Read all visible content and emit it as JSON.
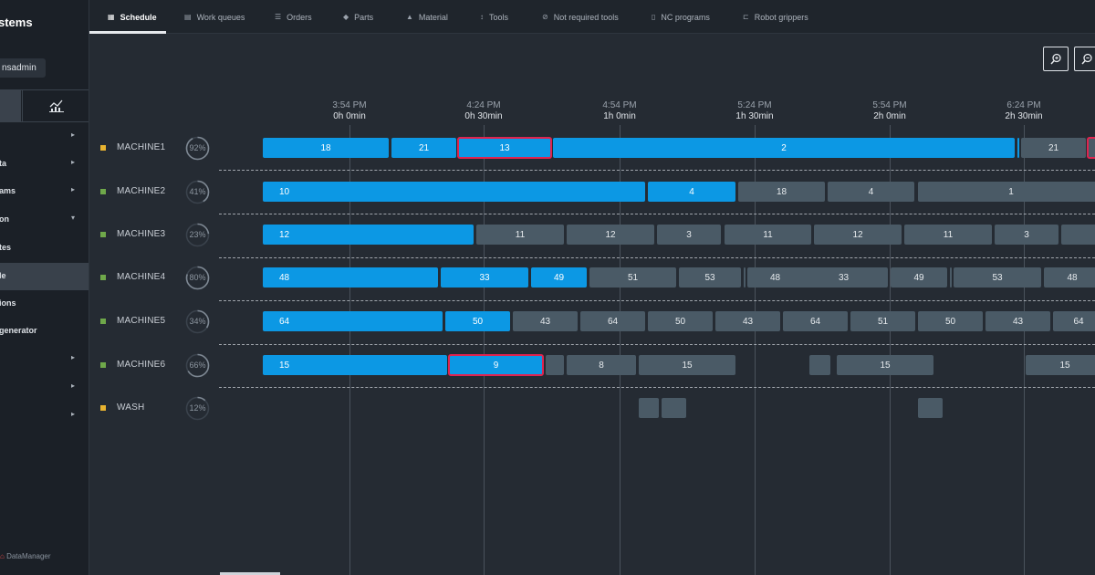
{
  "sidebar": {
    "brand": "stems",
    "user": "nsadmin",
    "items": [
      {
        "label": "",
        "chevron": "▸",
        "active": false
      },
      {
        "label": "ta",
        "chevron": "▸",
        "active": false
      },
      {
        "label": "ams",
        "chevron": "▸",
        "active": false
      },
      {
        "label": "on",
        "chevron": "▾",
        "active": false
      },
      {
        "label": "tes",
        "chevron": "",
        "active": false
      },
      {
        "label": "le",
        "chevron": "",
        "active": true
      },
      {
        "label": "ions",
        "chevron": "",
        "active": false
      },
      {
        "label": "generator",
        "chevron": "",
        "active": false
      },
      {
        "label": "",
        "chevron": "▸",
        "active": false
      },
      {
        "label": "",
        "chevron": "▸",
        "active": false
      },
      {
        "label": "",
        "chevron": "▸",
        "active": false
      }
    ],
    "footer": "DataManager"
  },
  "tabs": [
    {
      "label": "Schedule",
      "icon": "calendar-icon",
      "glyph": "▦",
      "active": true
    },
    {
      "label": "Work queues",
      "icon": "queue-icon",
      "glyph": "▤",
      "active": false
    },
    {
      "label": "Orders",
      "icon": "list-icon",
      "glyph": "☰",
      "active": false
    },
    {
      "label": "Parts",
      "icon": "part-icon",
      "glyph": "◆",
      "active": false
    },
    {
      "label": "Material",
      "icon": "material-icon",
      "glyph": "▲",
      "active": false
    },
    {
      "label": "Tools",
      "icon": "tool-icon",
      "glyph": "↕",
      "active": false
    },
    {
      "label": "Not required tools",
      "icon": "not-required-icon",
      "glyph": "⊘",
      "active": false
    },
    {
      "label": "NC programs",
      "icon": "nc-program-icon",
      "glyph": "▯",
      "active": false
    },
    {
      "label": "Robot grippers",
      "icon": "gripper-icon",
      "glyph": "⊏",
      "active": false
    }
  ],
  "timeline": [
    {
      "clock": "3:54 PM",
      "elapsed": "0h 0min"
    },
    {
      "clock": "4:24 PM",
      "elapsed": "0h 30min"
    },
    {
      "clock": "4:54 PM",
      "elapsed": "1h 0min"
    },
    {
      "clock": "5:24 PM",
      "elapsed": "1h 30min"
    },
    {
      "clock": "5:54 PM",
      "elapsed": "2h 0min"
    },
    {
      "clock": "6:24 PM",
      "elapsed": "2h 30min"
    }
  ],
  "colors": {
    "running": "#0c98e4",
    "queued": "#4a5a66",
    "selected_outline": "#e0234f",
    "status_warning": "#e8b330",
    "status_ok": "#6fa84a"
  },
  "machines": [
    {
      "name": "MACHINE1",
      "status": "warning",
      "utilization": 92,
      "utilization_label": "92%",
      "jobs": [
        {
          "label": "18",
          "kind": "running",
          "start": 288,
          "end": 426
        },
        {
          "label": "21",
          "kind": "running",
          "start": 429,
          "end": 500
        },
        {
          "label": "13",
          "kind": "running",
          "start": 502,
          "end": 604,
          "selected": true
        },
        {
          "label": "2",
          "kind": "running",
          "start": 606,
          "end": 1112
        },
        {
          "label": "",
          "kind": "running",
          "start": 1115,
          "end": 1117
        },
        {
          "label": "21",
          "kind": "queued",
          "start": 1119,
          "end": 1190
        },
        {
          "label": "",
          "kind": "queued",
          "start": 1192,
          "end": 1210,
          "selected": true
        }
      ]
    },
    {
      "name": "MACHINE2",
      "status": "ok",
      "utilization": 41,
      "utilization_label": "41%",
      "jobs": [
        {
          "label": "10",
          "kind": "running",
          "start": 288,
          "end": 707,
          "pad": true
        },
        {
          "label": "4",
          "kind": "running",
          "start": 710,
          "end": 806
        },
        {
          "label": "18",
          "kind": "queued",
          "start": 809,
          "end": 904
        },
        {
          "label": "4",
          "kind": "queued",
          "start": 907,
          "end": 1002
        },
        {
          "label": "1",
          "kind": "queued",
          "start": 1006,
          "end": 1396
        }
      ]
    },
    {
      "name": "MACHINE3",
      "status": "ok",
      "utilization": 23,
      "utilization_label": "23%",
      "jobs": [
        {
          "label": "12",
          "kind": "running",
          "start": 288,
          "end": 519,
          "pad": true
        },
        {
          "label": "11",
          "kind": "queued",
          "start": 522,
          "end": 618
        },
        {
          "label": "12",
          "kind": "queued",
          "start": 621,
          "end": 717
        },
        {
          "label": "3",
          "kind": "queued",
          "start": 720,
          "end": 790
        },
        {
          "label": "11",
          "kind": "queued",
          "start": 794,
          "end": 889
        },
        {
          "label": "12",
          "kind": "queued",
          "start": 892,
          "end": 988
        },
        {
          "label": "11",
          "kind": "queued",
          "start": 991,
          "end": 1087
        },
        {
          "label": "3",
          "kind": "queued",
          "start": 1090,
          "end": 1160
        },
        {
          "label": "",
          "kind": "queued",
          "start": 1163,
          "end": 1210
        }
      ]
    },
    {
      "name": "MACHINE4",
      "status": "ok",
      "utilization": 80,
      "utilization_label": "80%",
      "jobs": [
        {
          "label": "48",
          "kind": "running",
          "start": 288,
          "end": 480,
          "pad": true
        },
        {
          "label": "33",
          "kind": "running",
          "start": 483,
          "end": 579
        },
        {
          "label": "49",
          "kind": "running",
          "start": 582,
          "end": 643
        },
        {
          "label": "51",
          "kind": "queued",
          "start": 646,
          "end": 741
        },
        {
          "label": "53",
          "kind": "queued",
          "start": 744,
          "end": 812
        },
        {
          "label": "",
          "kind": "queued",
          "start": 815,
          "end": 817
        },
        {
          "label": "48",
          "kind": "queued",
          "start": 819,
          "end": 880
        },
        {
          "label": "33",
          "kind": "queued",
          "start": 876,
          "end": 973
        },
        {
          "label": "49",
          "kind": "queued",
          "start": 976,
          "end": 1038
        },
        {
          "label": "",
          "kind": "queued",
          "start": 1041,
          "end": 1043
        },
        {
          "label": "53",
          "kind": "queued",
          "start": 1045,
          "end": 1141
        },
        {
          "label": "48",
          "kind": "queued",
          "start": 1144,
          "end": 1206
        }
      ]
    },
    {
      "name": "MACHINE5",
      "status": "ok",
      "utilization": 34,
      "utilization_label": "34%",
      "jobs": [
        {
          "label": "64",
          "kind": "running",
          "start": 288,
          "end": 485,
          "pad": true
        },
        {
          "label": "50",
          "kind": "running",
          "start": 488,
          "end": 559
        },
        {
          "label": "43",
          "kind": "queued",
          "start": 562,
          "end": 633
        },
        {
          "label": "64",
          "kind": "queued",
          "start": 636,
          "end": 707
        },
        {
          "label": "50",
          "kind": "queued",
          "start": 710,
          "end": 781
        },
        {
          "label": "43",
          "kind": "queued",
          "start": 784,
          "end": 855
        },
        {
          "label": "64",
          "kind": "queued",
          "start": 858,
          "end": 929
        },
        {
          "label": "51",
          "kind": "queued",
          "start": 932,
          "end": 1003
        },
        {
          "label": "50",
          "kind": "queued",
          "start": 1006,
          "end": 1077
        },
        {
          "label": "43",
          "kind": "queued",
          "start": 1080,
          "end": 1151
        },
        {
          "label": "64",
          "kind": "queued",
          "start": 1154,
          "end": 1225
        }
      ]
    },
    {
      "name": "MACHINE6",
      "status": "ok",
      "utilization": 66,
      "utilization_label": "66%",
      "jobs": [
        {
          "label": "15",
          "kind": "running",
          "start": 288,
          "end": 490,
          "pad": true
        },
        {
          "label": "9",
          "kind": "running",
          "start": 492,
          "end": 595,
          "selected": true
        },
        {
          "label": "",
          "kind": "queued",
          "start": 598,
          "end": 618
        },
        {
          "label": "8",
          "kind": "queued",
          "start": 621,
          "end": 697
        },
        {
          "label": "15",
          "kind": "queued",
          "start": 700,
          "end": 806
        },
        {
          "label": "",
          "kind": "queued",
          "start": 887,
          "end": 910
        },
        {
          "label": "15",
          "kind": "queued",
          "start": 917,
          "end": 1023
        },
        {
          "label": "15",
          "kind": "queued",
          "start": 1124,
          "end": 1230
        }
      ]
    },
    {
      "name": "WASH",
      "status": "warning",
      "utilization": 12,
      "utilization_label": "12%",
      "jobs": [
        {
          "label": "",
          "kind": "queued",
          "start": 700,
          "end": 722
        },
        {
          "label": "",
          "kind": "queued",
          "start": 725,
          "end": 752
        },
        {
          "label": "",
          "kind": "queued",
          "start": 1006,
          "end": 1033
        }
      ]
    }
  ]
}
